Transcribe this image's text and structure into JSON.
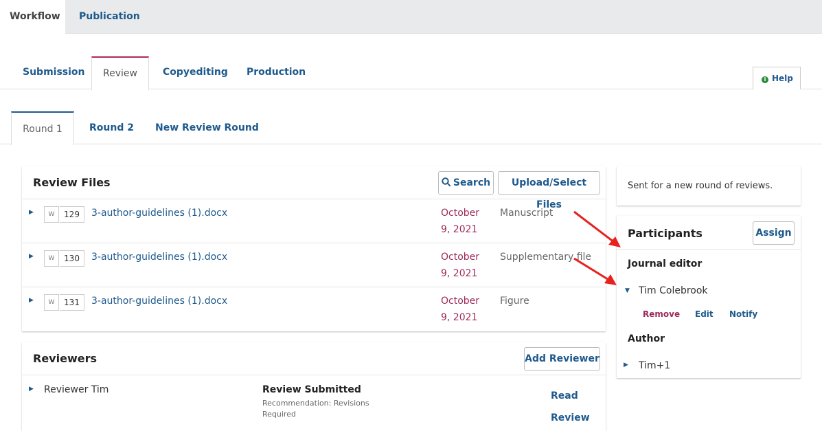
{
  "top_tabs": [
    "Workflow",
    "Publication"
  ],
  "stage_tabs": [
    "Submission",
    "Review",
    "Copyediting",
    "Production"
  ],
  "help": {
    "label": "Help",
    "icon": "info-icon"
  },
  "round_tabs": [
    "Round 1",
    "Round 2",
    "New Review Round"
  ],
  "review_files": {
    "title": "Review Files",
    "search_label": "Search",
    "upload_label": "Upload/Select Files",
    "files": [
      {
        "id": "129",
        "name": "3-author-guidelines (1).docx",
        "date": "October 9, 2021",
        "type": "Manuscript"
      },
      {
        "id": "130",
        "name": "3-author-guidelines (1).docx",
        "date": "October 9, 2021",
        "type": "Supplementary file"
      },
      {
        "id": "131",
        "name": "3-author-guidelines (1).docx",
        "date": "October 9, 2021",
        "type": "Figure"
      }
    ]
  },
  "reviewers": {
    "title": "Reviewers",
    "add_label": "Add Reviewer",
    "items": [
      {
        "name": "Reviewer Tim",
        "status": "Review Submitted",
        "recommendation": "Recommendation: Revisions Required",
        "action": "Read Review"
      }
    ]
  },
  "notice": "Sent for a new round of reviews.",
  "participants": {
    "title": "Participants",
    "assign_label": "Assign",
    "groups": [
      {
        "role": "Journal editor",
        "members": [
          {
            "name": "Tim Colebrook",
            "actions": [
              "Remove",
              "Edit",
              "Notify"
            ]
          }
        ]
      },
      {
        "role": "Author",
        "members": [
          {
            "name": "Tim+1"
          }
        ]
      }
    ]
  },
  "colors": {
    "link": "#1e5a8d",
    "date": "#9d2a59",
    "remove": "#9d2a59",
    "arrow": "#e8211f"
  }
}
